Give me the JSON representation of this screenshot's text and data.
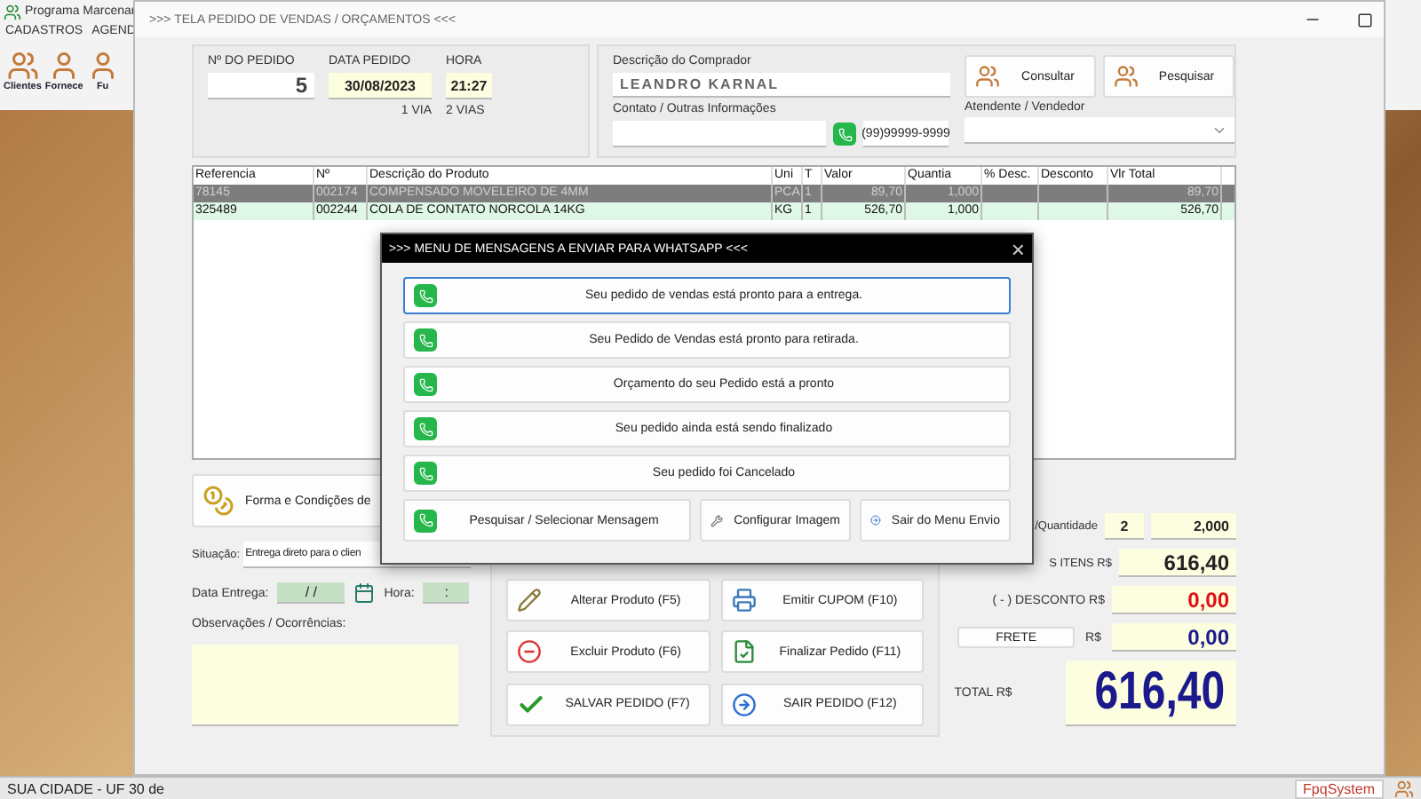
{
  "app": {
    "title": "Programa Marcenar",
    "menu": [
      "CADASTROS",
      "AGEND"
    ],
    "toolbar": [
      {
        "label": "Clientes",
        "kind": "group"
      },
      {
        "label": "Fornece",
        "kind": "person"
      },
      {
        "label": "Fu",
        "kind": "person"
      }
    ],
    "location": "SUA CIDADE - UF 30 de",
    "brand": "FpqSystem"
  },
  "window": {
    "title": ">>> TELA PEDIDO DE VENDAS / ORÇAMENTOS <<<"
  },
  "order": {
    "number_label": "Nº DO PEDIDO",
    "number": "5",
    "date_label": "DATA PEDIDO",
    "date": "30/08/2023",
    "time_label": "HORA",
    "time": "21:27",
    "copies": [
      "1 VIA",
      "2 VIAS"
    ]
  },
  "buyer": {
    "label": "Descrição do Comprador",
    "value": "LEANDRO KARNAL",
    "buttons": [
      "Consultar",
      "Pesquisar"
    ],
    "contact_label": "Contato / Outras Informações",
    "phone": "(99)99999-9999",
    "seller_label": "Atendente / Vendedor"
  },
  "table": {
    "columns": [
      "Referencia",
      "Nº",
      "Descrição do Produto",
      "Uni",
      "T",
      "Valor",
      "Quantia",
      "% Desc.",
      "Desconto",
      "Vlr Total"
    ],
    "rows": [
      {
        "cells": [
          "78145",
          "002174",
          "COMPENSADO MOVELEIRO DE 4MM",
          "PCA",
          "1",
          "89,70",
          "1,000",
          "",
          "",
          "89,70"
        ],
        "selected": true
      },
      {
        "cells": [
          "325489",
          "002244",
          "COLA DE CONTATO NORCOLA 14KG",
          "KG",
          "1",
          "526,70",
          "1,000",
          "",
          "",
          "526,70"
        ],
        "selected": false
      }
    ]
  },
  "payment_button": "Forma e Condições de",
  "situation": {
    "label": "Situação:",
    "value": "Entrega direto para o clien"
  },
  "delivery": {
    "label": "Data Entrega:",
    "date": "/ /",
    "time_label": "Hora:",
    "time": ":"
  },
  "notes_label": "Observações / Ocorrências:",
  "actions": [
    {
      "label": "Alterar Produto (F5)",
      "kind": "edit"
    },
    {
      "label": "Emitir CUPOM (F10)",
      "kind": "print"
    },
    {
      "label": "Excluir Produto (F6)",
      "kind": "delete"
    },
    {
      "label": "Finalizar Pedido (F11)",
      "kind": "finish"
    },
    {
      "label": "SALVAR PEDIDO (F7)",
      "kind": "save"
    },
    {
      "label": "SAIR PEDIDO (F12)",
      "kind": "exit"
    }
  ],
  "totals": {
    "quantity_label": "/Quantidade",
    "items_count": "2",
    "quantity": "2,000",
    "items_label": "S ITENS R$",
    "items_total": "616,40",
    "discount_label": "( - ) DESCONTO R$",
    "discount": "0,00",
    "freight_button": "FRETE",
    "freight_label": "R$",
    "freight": "0,00",
    "total_label": "TOTAL R$",
    "total": "616,40"
  },
  "dialog": {
    "title": ">>> MENU DE MENSAGENS A ENVIAR PARA WHATSAPP <<<",
    "close": "×",
    "messages": [
      {
        "text": "Seu pedido de vendas está pronto para a entrega.",
        "selected": true
      },
      {
        "text": "Seu Pedido de Vendas está pronto para retirada.",
        "selected": false
      },
      {
        "text": "Orçamento do seu Pedido está a pronto",
        "selected": false
      },
      {
        "text": "Seu pedido ainda está sendo finalizado",
        "selected": false
      },
      {
        "text": "Seu pedido foi Cancelado",
        "selected": false
      }
    ],
    "buttons": [
      {
        "label": "Pesquisar / Selecionar Mensagem",
        "kind": "whatsapp"
      },
      {
        "label": "Configurar Imagem",
        "kind": "tools"
      },
      {
        "label": "Sair do Menu Envio",
        "kind": "exit"
      }
    ]
  }
}
